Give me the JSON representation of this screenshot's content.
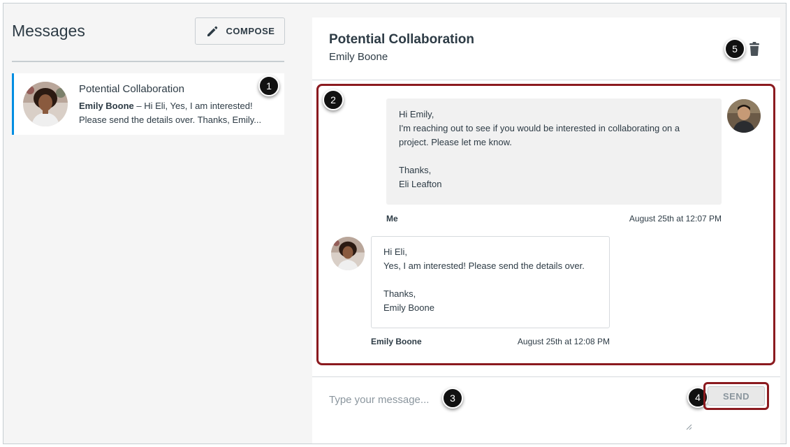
{
  "sidebar": {
    "title": "Messages",
    "compose_label": "COMPOSE",
    "conversations": [
      {
        "subject": "Potential Collaboration",
        "sender": "Emily Boone",
        "preview_line1": " – Hi Eli, Yes, I am interested!",
        "preview_line2": "Please send the details over. Thanks, Emily..."
      }
    ]
  },
  "conversation": {
    "title": "Potential Collaboration",
    "participant": "Emily Boone",
    "messages": [
      {
        "lines": [
          "Hi Emily,",
          "I'm reaching out to see if you would be interested in collaborating on a",
          "project. Please let me know.",
          "",
          "Thanks,",
          "Eli Leafton"
        ],
        "author": "Me",
        "timestamp": "August 25th at 12:07 PM"
      },
      {
        "lines": [
          "Hi Eli,",
          "Yes, I am interested! Please send the details over.",
          "",
          "Thanks,",
          "Emily Boone"
        ],
        "author": "Emily Boone",
        "timestamp": "August 25th at 12:08 PM"
      }
    ]
  },
  "reply": {
    "placeholder": "Type your message...",
    "send_label": "SEND"
  },
  "callouts": [
    "1",
    "2",
    "3",
    "4",
    "5"
  ],
  "colors": {
    "accent": "#008ee2",
    "highlight": "#8b1a1f",
    "text": "#2d3b45"
  }
}
